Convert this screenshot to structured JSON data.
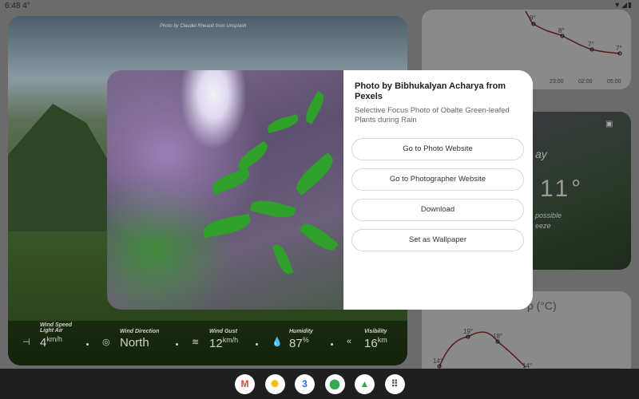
{
  "status_bar": {
    "time": "6:48",
    "temperature": "4°",
    "icons": [
      "wifi-icon",
      "signal-icon",
      "battery-icon"
    ]
  },
  "main_card": {
    "photo_credit": "Photo by Claudel Rheault from Unsplash",
    "metrics": [
      {
        "label": "Wind Speed",
        "sublabel": "Light Air",
        "value": "4",
        "unit": "km/h",
        "icon": "wind-speed-icon"
      },
      {
        "label": "Wind Direction",
        "value": "North",
        "unit": "",
        "icon": "compass-icon"
      },
      {
        "label": "Wind Gust",
        "value": "12",
        "unit": "km/h",
        "icon": "wind-gust-icon"
      },
      {
        "label": "Humidity",
        "value": "87",
        "unit": "%",
        "icon": "humidity-icon"
      },
      {
        "label": "Visibility",
        "value": "16",
        "unit": "km",
        "icon": "visibility-icon"
      }
    ]
  },
  "hourly_chart": {
    "points": [
      "9°",
      "8°",
      "7°",
      "7°"
    ],
    "times": [
      "23:00",
      "02:00",
      "05:00"
    ],
    "values": [
      9,
      8,
      7,
      7
    ]
  },
  "daily_card": {
    "partial_title": "ay",
    "partial_temp": "11°",
    "partial_text1": "possible",
    "partial_text2": "eeze"
  },
  "temp_chart": {
    "partial_title": "p (°C)",
    "points": [
      "14°",
      "19°",
      "18°",
      "14°"
    ],
    "values": [
      14,
      19,
      18,
      14
    ]
  },
  "dialog": {
    "title": "Photo by Bibhukalyan Acharya from Pexels",
    "description": "Selective Focus Photo of Obalte Green-leafed Plants during Rain",
    "buttons": [
      "Go to Photo Website",
      "Go to Photographer Website",
      "Download",
      "Set as Wallpaper"
    ]
  },
  "taskbar": {
    "apps": [
      {
        "name": "Gmail",
        "glyph": "M",
        "color": "#ea4335"
      },
      {
        "name": "Photos",
        "glyph": "✺",
        "color": "#fbbc04"
      },
      {
        "name": "Calendar",
        "glyph": "3",
        "color": "#1a73e8"
      },
      {
        "name": "Maps",
        "glyph": "⬤",
        "color": "#34a853"
      },
      {
        "name": "Drive",
        "glyph": "▲",
        "color": "#34a853"
      },
      {
        "name": "App drawer",
        "glyph": "⠿",
        "color": "#444"
      }
    ]
  }
}
